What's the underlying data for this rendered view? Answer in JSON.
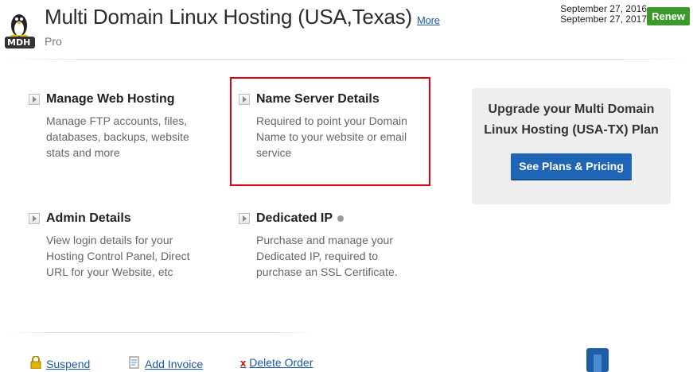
{
  "header": {
    "title": "Multi Domain Linux Hosting (USA,Texas)",
    "more_link": "More",
    "subtitle": "Pro",
    "logo_text": "MDH",
    "date_start": "September 27, 2016",
    "date_end": "September 27, 2017",
    "renew_label": "Renew"
  },
  "sections": {
    "manage": {
      "title": "Manage Web Hosting",
      "desc": "Manage FTP accounts, files, databases, backups, website stats and more"
    },
    "nameserver": {
      "title": "Name Server Details",
      "desc": "Required to point your Domain Name to your website or email service"
    },
    "admin": {
      "title": "Admin Details",
      "desc": "View login details for your Hosting Control Panel, Direct URL for your Website, etc"
    },
    "dedicated": {
      "title": "Dedicated IP",
      "desc": "Purchase and manage your Dedicated IP, required to purchase an SSL Certificate."
    }
  },
  "upgrade": {
    "text": "Upgrade your Multi Domain Linux Hosting (USA-TX) Plan",
    "button": "See Plans & Pricing"
  },
  "footer": {
    "suspend": "Suspend",
    "add_invoice": "Add Invoice",
    "delete_order": "Delete Order"
  },
  "colors": {
    "renew": "#3c9a2d",
    "primary_button": "#1f66b6",
    "highlight": "#e3000f",
    "link": "#1a5aa8"
  },
  "icons": [
    "linux-penguin-icon",
    "arrow-right-icon",
    "info-dot-icon",
    "lock-icon",
    "invoice-icon",
    "x-icon"
  ]
}
